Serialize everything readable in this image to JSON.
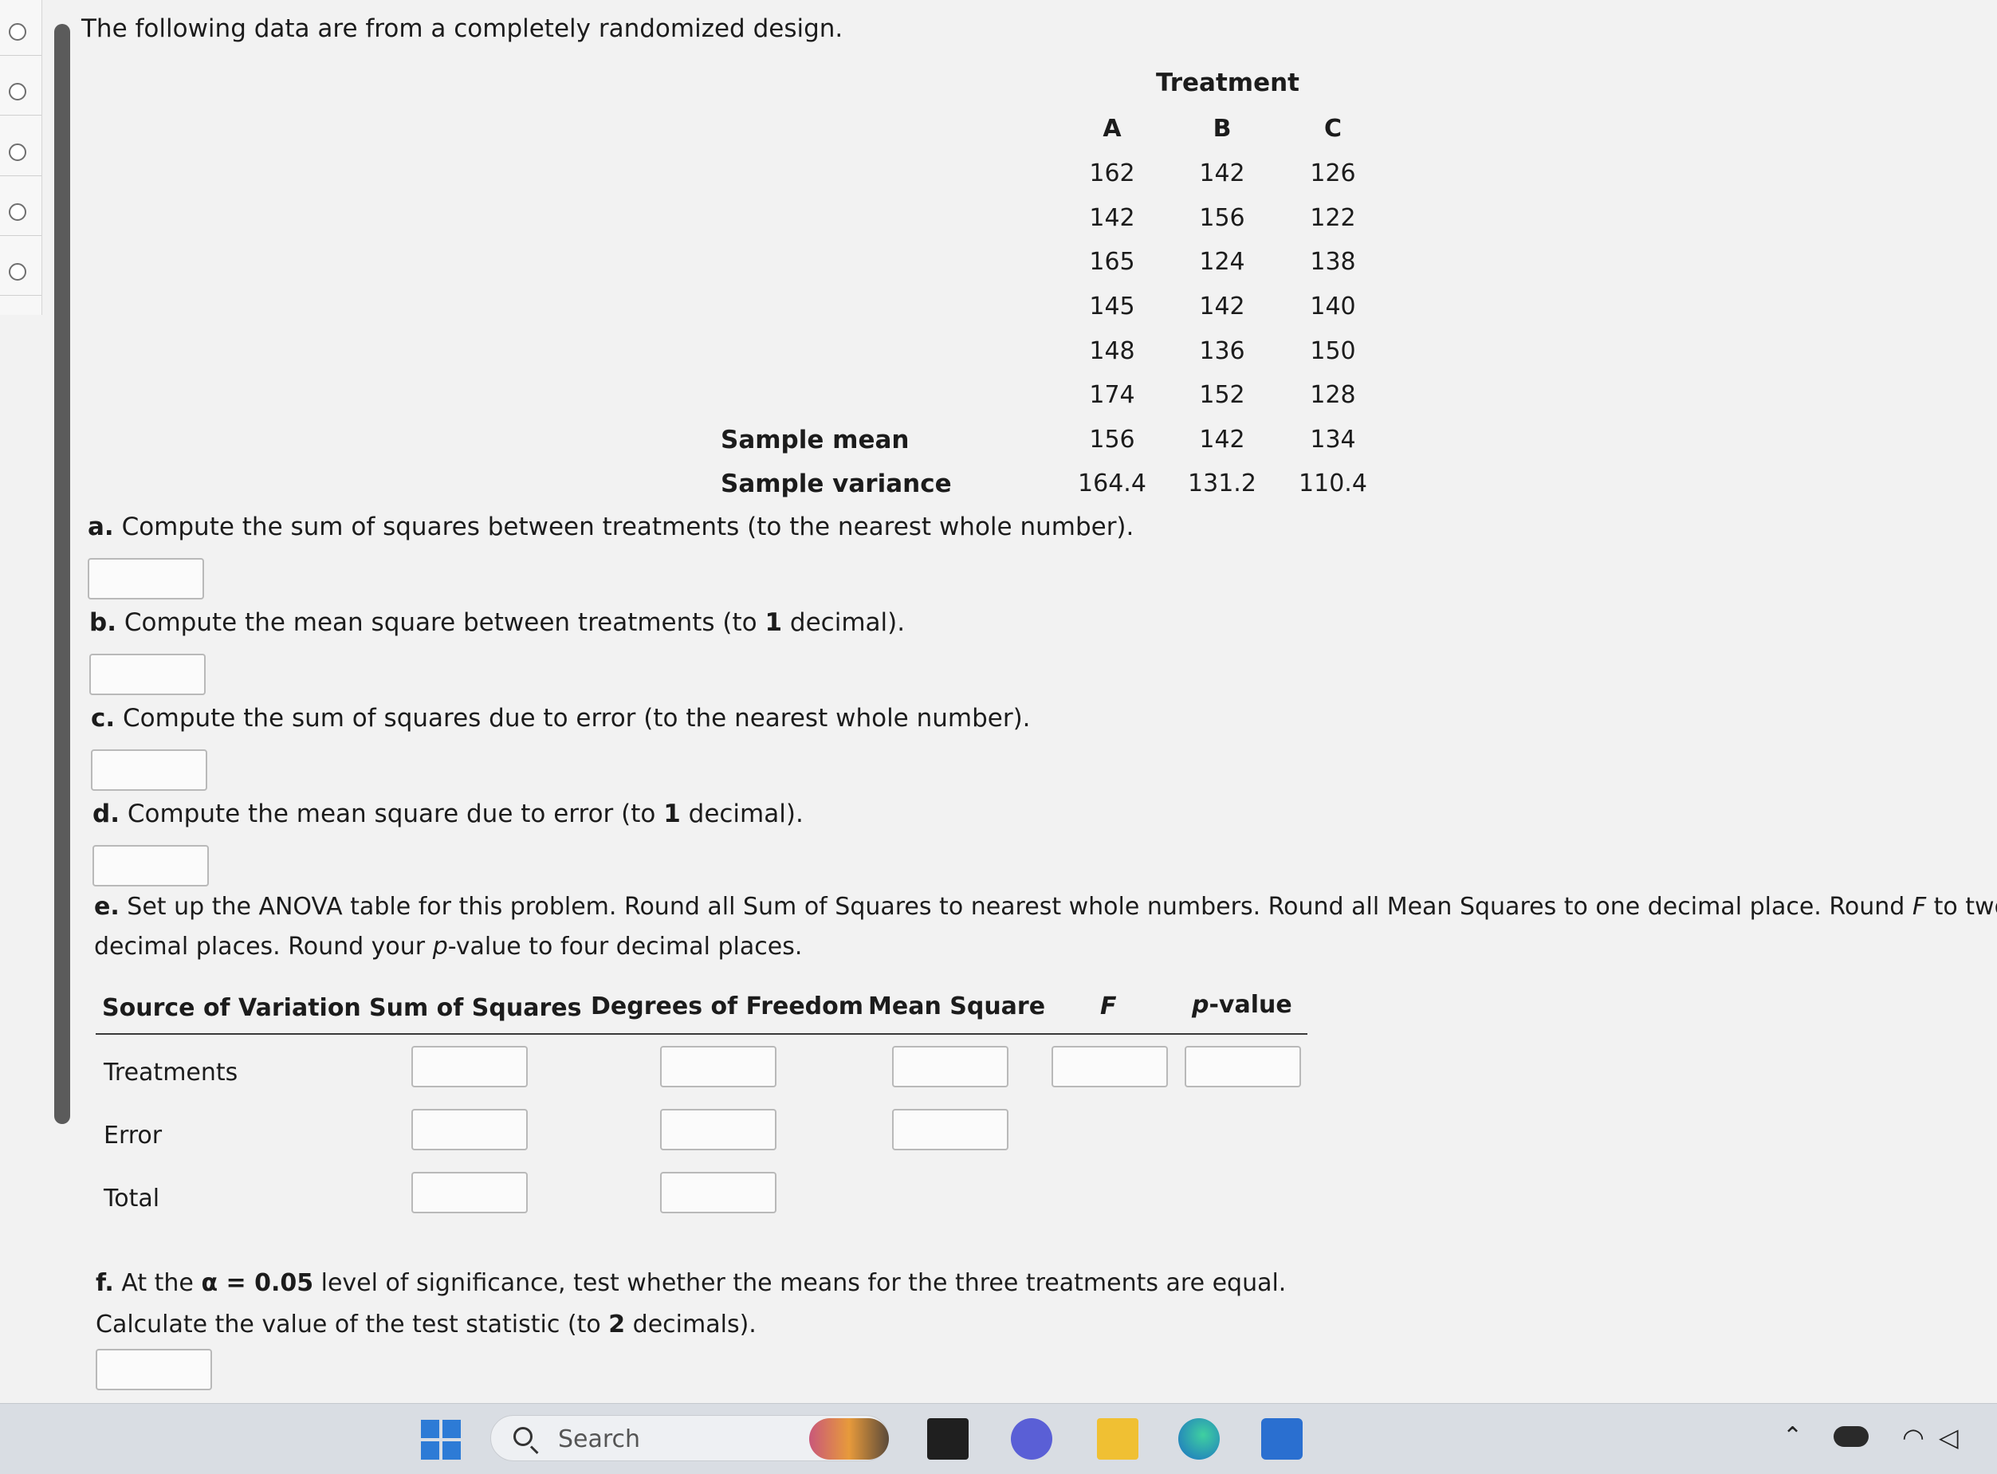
{
  "intro": "The following data are from a completely randomized design.",
  "table": {
    "group_header": "Treatment",
    "columns": [
      "A",
      "B",
      "C"
    ],
    "rows": [
      [
        "162",
        "142",
        "126"
      ],
      [
        "142",
        "156",
        "122"
      ],
      [
        "165",
        "124",
        "138"
      ],
      [
        "145",
        "142",
        "140"
      ],
      [
        "148",
        "136",
        "150"
      ],
      [
        "174",
        "152",
        "128"
      ]
    ],
    "sample_mean_label": "Sample mean",
    "sample_mean": [
      "156",
      "142",
      "134"
    ],
    "sample_variance_label": "Sample variance",
    "sample_variance": [
      "164.4",
      "131.2",
      "110.4"
    ]
  },
  "questions": {
    "a": {
      "letter": "a.",
      "text": "Compute the sum of squares between treatments (to the nearest whole number).",
      "value": ""
    },
    "b": {
      "letter": "b.",
      "text_pre": "Compute the mean square between treatments (to ",
      "n": "1",
      "text_post": " decimal).",
      "value": ""
    },
    "c": {
      "letter": "c.",
      "text": "Compute the sum of squares due to error (to the nearest whole number).",
      "value": ""
    },
    "d": {
      "letter": "d.",
      "text_pre": "Compute the mean square due to error (to ",
      "n": "1",
      "text_post": " decimal).",
      "value": ""
    },
    "e": {
      "letter": "e.",
      "line1_pre": "Set up the ANOVA table for this problem. Round all Sum of Squares to nearest whole numbers. Round all Mean Squares to one decimal place. Round ",
      "line1_var": "F",
      "line1_post": " to two",
      "line2_pre": "decimal places. Round your ",
      "line2_var": "p",
      "line2_post": "-value to four decimal places."
    },
    "f": {
      "letter": "f.",
      "line1_pre": "At the ",
      "alpha": "α = 0.05",
      "line1_post": " level of significance, test whether the means for the three treatments are equal.",
      "line2_pre": "Calculate the value of the test statistic (to ",
      "n": "2",
      "line2_post": " decimals).",
      "value": ""
    }
  },
  "anova": {
    "headers": {
      "source": "Source of Variation",
      "ss": "Sum of Squares",
      "df": "Degrees of Freedom",
      "ms": "Mean Square",
      "f": "F",
      "p_var": "p",
      "p_rest": "-value"
    },
    "rows": [
      "Treatments",
      "Error",
      "Total"
    ]
  },
  "taskbar": {
    "search_placeholder": "Search",
    "icons": [
      "windows-start-icon",
      "search-icon",
      "widgets-icon",
      "file-explorer-icon",
      "chat-icon",
      "folder-icon",
      "edge-icon",
      "store-icon"
    ],
    "tray": [
      "chevron-up-icon",
      "cloud-icon",
      "wifi-icon",
      "speaker-icon"
    ]
  },
  "colors": {
    "page_bg": "#f2f2f2",
    "box_border": "#b9b9b9",
    "taskbar_bg": "#d9dde3",
    "windows_blue": "#2d7bd6"
  }
}
